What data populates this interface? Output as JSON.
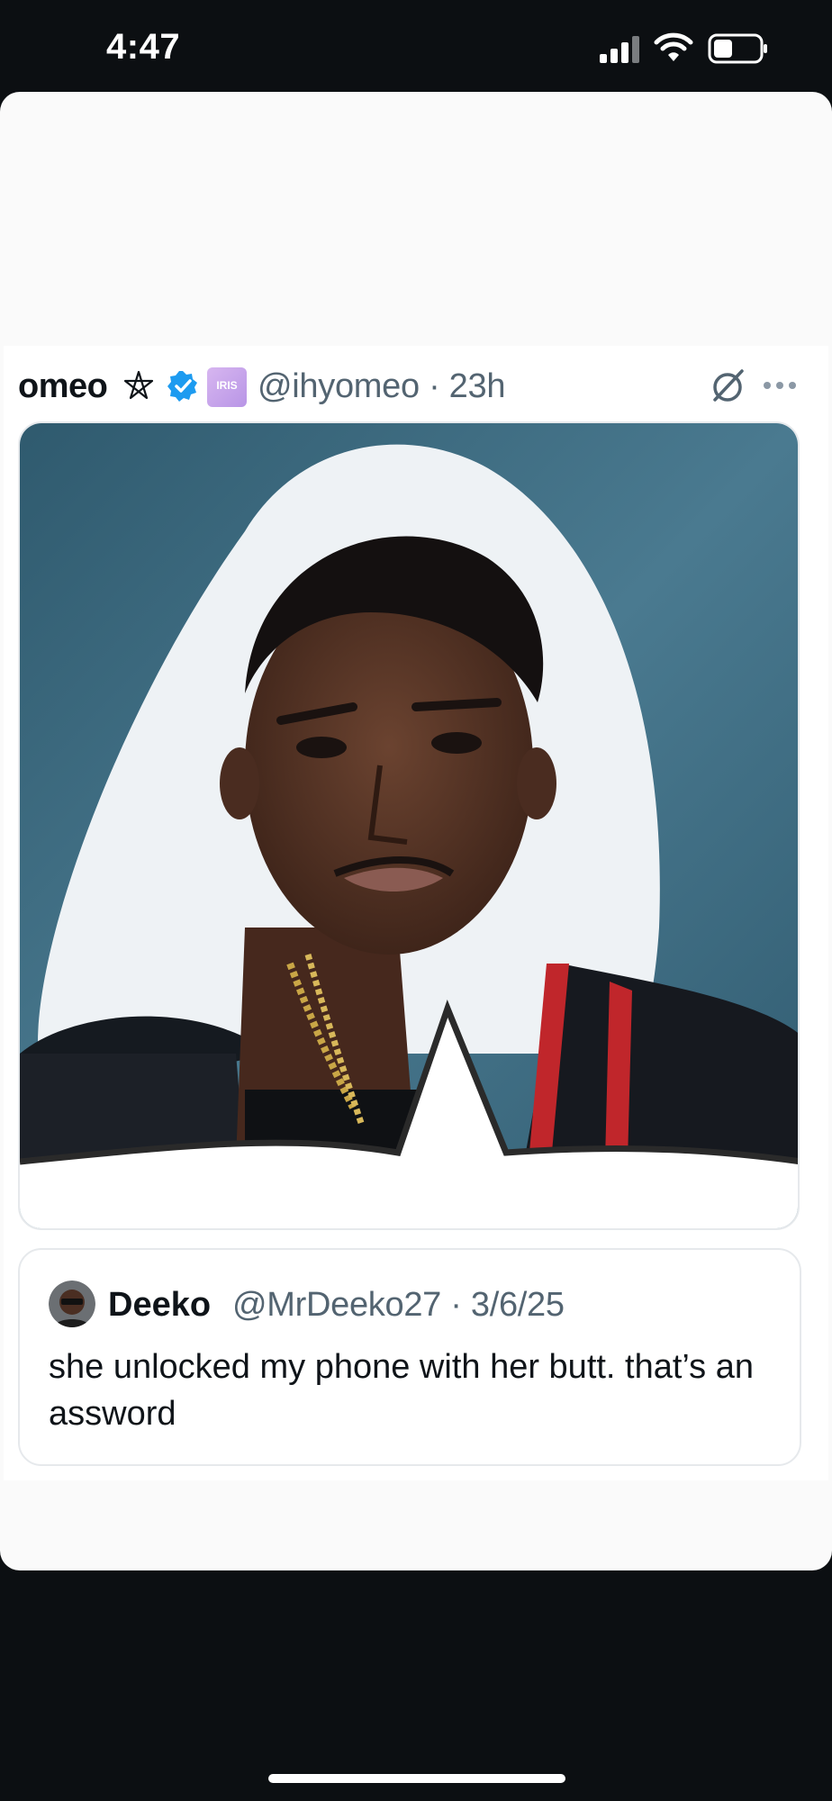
{
  "status_bar": {
    "time": "4:47"
  },
  "post": {
    "author_name": "omeo",
    "handle_and_time": "@ihyomeo · 23h",
    "badge_text": "IRIS",
    "icons": [
      "pentagram-icon",
      "verified-icon",
      "grok-icon",
      "more-icon"
    ]
  },
  "quote": {
    "name": "Deeko",
    "handle_and_date": "@MrDeeko27 · 3/6/25",
    "text": "she unlocked my phone with her butt. that’s an assword"
  },
  "colors": {
    "accent_verified": "#1d9bf0",
    "photo_background": "#3f6b80",
    "secondary_text": "#536471"
  }
}
